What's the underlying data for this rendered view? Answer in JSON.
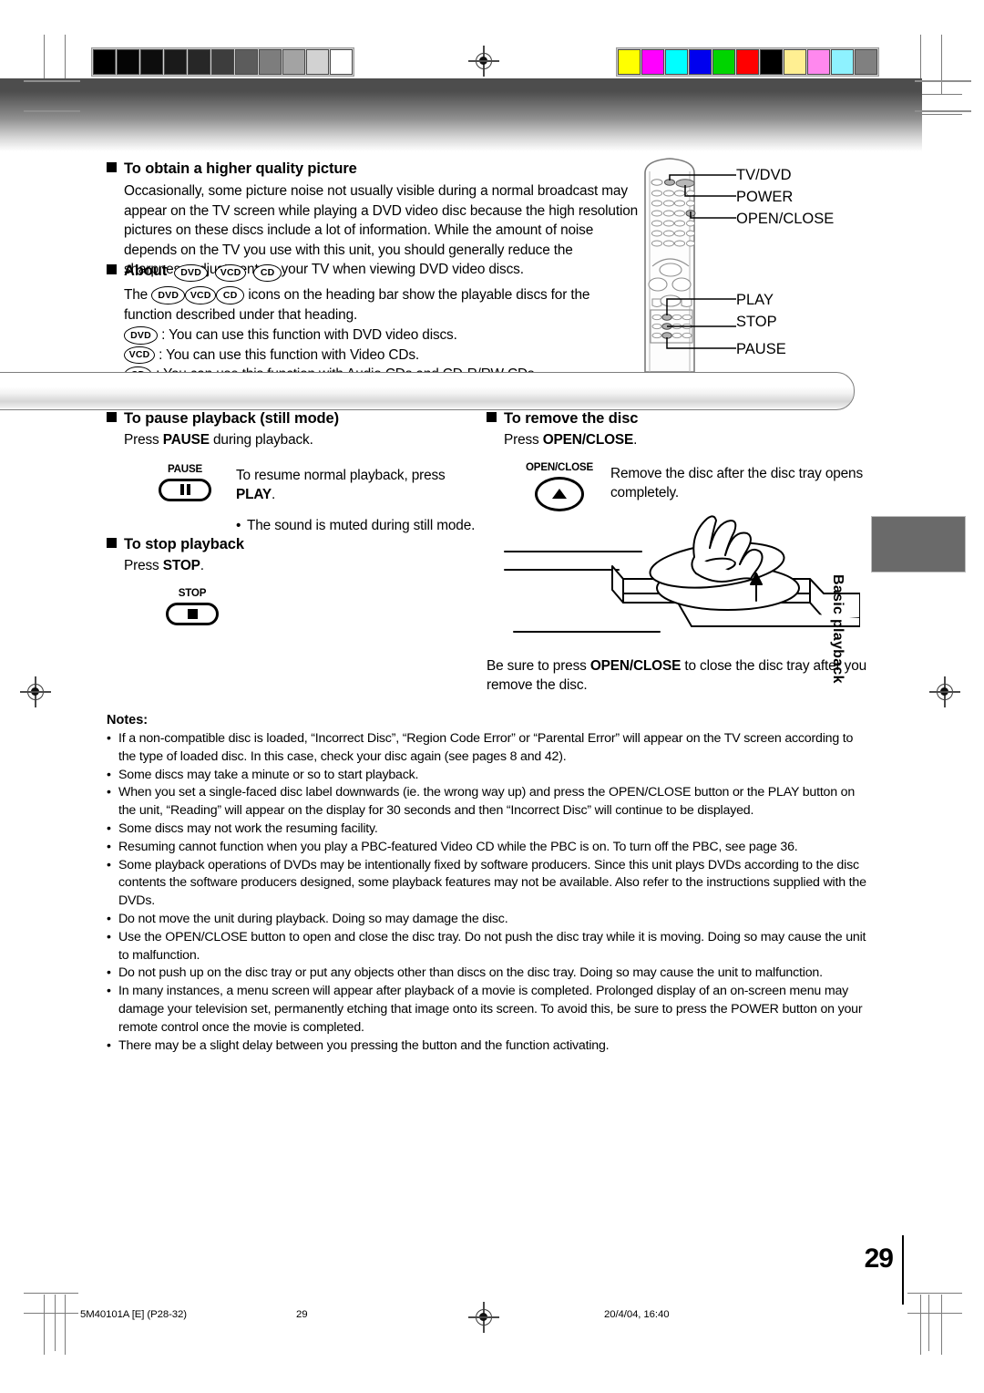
{
  "page": {
    "number": "29",
    "side_tab": "Basic playback"
  },
  "calibration": {
    "grayscale": [
      "#000000",
      "#050505",
      "#0d0d0d",
      "#1a1a1a",
      "#272727",
      "#3d3d3d",
      "#5c5c5c",
      "#7d7d7d",
      "#a3a3a3",
      "#d2d2d2",
      "#ffffff"
    ],
    "colors": [
      "#ffff00",
      "#ff00ff",
      "#00ffff",
      "#0000ee",
      "#00d400",
      "#ff0000",
      "#000000",
      "#ffef92",
      "#ff88ee",
      "#8ef2ff",
      "#808080"
    ]
  },
  "section_quality": {
    "heading": "To obtain a higher quality picture",
    "body": "Occasionally, some picture noise not usually visible during a normal broadcast may appear on the TV screen while playing a DVD video disc because the high resolution pictures on these discs include a lot of information. While the amount of noise depends on the TV you use with this unit, you should generally reduce the sharpness adjustment on your TV when viewing DVD video discs."
  },
  "section_about": {
    "heading": "About",
    "icons": [
      "DVD",
      "VCD",
      "CD"
    ],
    "intro_before": "The",
    "intro_after": "icons on the heading bar show the playable discs for the function described under that heading.",
    "legend": [
      {
        "icon": "DVD",
        "text": ": You can use this function with DVD video discs."
      },
      {
        "icon": "VCD",
        "text": ": You can use this function with Video CDs."
      },
      {
        "icon": "CD",
        "text": ": You can use this function with Audio CDs and CD-R/RW CDs."
      }
    ]
  },
  "remote": {
    "callouts_top": [
      "TV/DVD",
      "POWER",
      "OPEN/CLOSE"
    ],
    "callouts_bottom": [
      "PLAY",
      "STOP",
      "PAUSE"
    ]
  },
  "section_pause": {
    "heading": "To pause playback (still mode)",
    "instruction_pre": "Press",
    "instruction_key": "PAUSE",
    "instruction_post": "during playback.",
    "button_label": "PAUSE",
    "button_icon": "pause-icon",
    "note_pre": "To resume normal playback, press",
    "note_key": "PLAY",
    "note_post": ".",
    "bullet": "The sound is muted during still mode."
  },
  "section_stop": {
    "heading": "To stop playback",
    "instruction_pre": "Press",
    "instruction_key": "STOP",
    "instruction_post": ".",
    "button_label": "STOP",
    "button_icon": "stop-icon"
  },
  "section_remove": {
    "heading": "To remove the disc",
    "instruction_pre": "Press",
    "instruction_key": "OPEN/CLOSE",
    "instruction_post": ".",
    "button_label": "OPEN/CLOSE",
    "button_icon": "eject-icon",
    "body": "Remove the disc after the disc tray opens completely.",
    "footer_pre": "Be sure to press",
    "footer_key": "OPEN/CLOSE",
    "footer_post": "to close the disc tray after you remove the disc."
  },
  "notes": {
    "title": "Notes:",
    "items": [
      "If a non-compatible disc is loaded, “Incorrect Disc”, “Region Code Error” or “Parental Error” will appear on the TV screen according to the type of loaded disc. In this case, check your disc again (see pages 8 and 42).",
      "Some discs may take a minute or so to start playback.",
      "When you set a single-faced disc label downwards (ie. the wrong way up) and press the OPEN/CLOSE button or the PLAY button on the unit, “Reading” will appear on the display for 30 seconds and then “Incorrect Disc” will continue to be displayed.",
      "Some discs may not work the resuming facility.",
      "Resuming cannot function when you play a PBC-featured Video CD while the PBC is on. To turn off the PBC, see page 36.",
      "Some playback operations of DVDs may be intentionally fixed by software producers. Since this unit plays DVDs according to the disc contents the software producers designed, some playback features may not be available. Also refer to the instructions supplied with the DVDs.",
      "Do not move the unit during playback. Doing so may damage the disc.",
      "Use the OPEN/CLOSE button to open and close the disc tray. Do not push the disc tray while it is moving. Doing so may cause the unit to malfunction.",
      "Do not push up on the disc tray or put any objects other than discs on the disc tray. Doing so may cause the unit to malfunction.",
      "In many instances, a menu screen will appear after playback of a movie is completed. Prolonged display of an on-screen menu may damage your television set, permanently etching that image onto its screen. To avoid this, be sure to press the POWER button on your remote control once the movie is completed.",
      "There may be a slight delay between you pressing the button and the function activating."
    ]
  },
  "footer": {
    "code": "5M40101A [E] (P28-32)",
    "page": "29",
    "date": "20/4/04, 16:40"
  }
}
